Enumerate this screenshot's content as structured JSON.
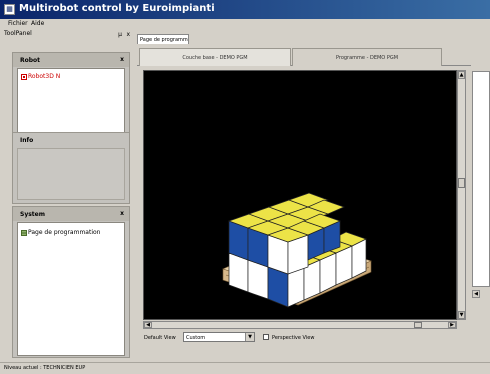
{
  "window": {
    "title": "Multirobot control by Euroimpianti"
  },
  "menu": {
    "items": [
      "Fichier",
      "Aide"
    ]
  },
  "left_pane": {
    "title": "ToolPanel",
    "pin": "µ",
    "close": "x",
    "robot_panel": {
      "header": "Robot",
      "close": "x",
      "items": [
        "Robot3D N"
      ]
    },
    "info_panel": {
      "header": "Info"
    },
    "system_panel": {
      "header": "System",
      "close": "x",
      "items": [
        "Page de programmation"
      ]
    }
  },
  "main": {
    "document_tab": "Page de programmation",
    "tabs": [
      "Couche base - DEMO PGM",
      "Programme - DEMO PGM"
    ],
    "active_tab": 0,
    "controls": {
      "default_view_label": "Default View",
      "default_view_value": "Custom",
      "dropdown_arrow": "▼",
      "perspective_label": "Perspective View",
      "perspective_checked": false
    }
  },
  "status": {
    "text": "Niveau actuel : TECHNICIEN EUP"
  },
  "colors": {
    "titlebar": "#0a246a",
    "viewport": "#000000",
    "box_top": "#ece347",
    "box_side_blue": "#1e4ea5",
    "box_side_white": "#ffffff",
    "pallet": "#e3c9a1"
  },
  "icons": {
    "robot": "robot-icon",
    "program_page": "page-icon"
  }
}
